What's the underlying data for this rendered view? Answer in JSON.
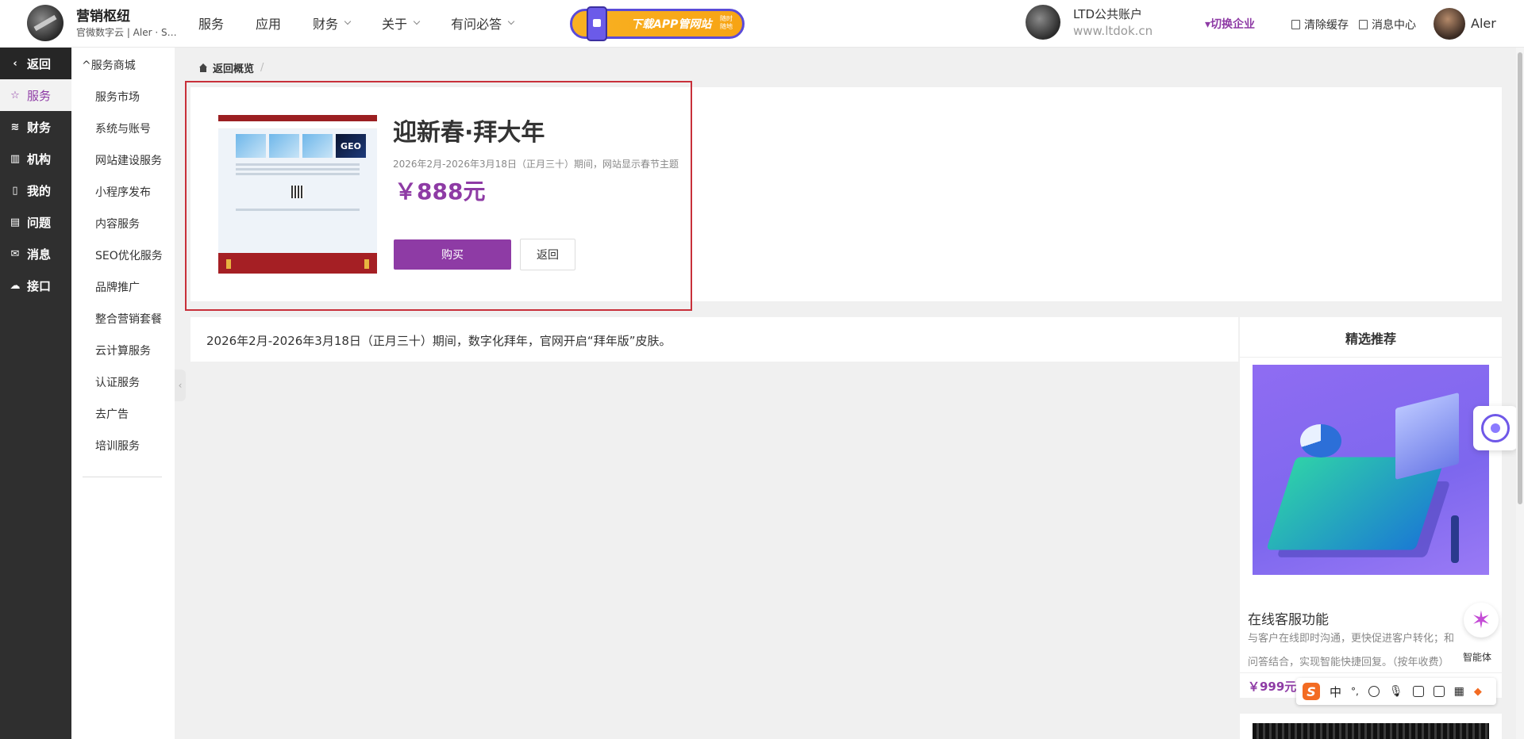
{
  "header": {
    "brand_title": "营销枢纽",
    "brand_subtitle": "官微数字云 | Aler · Se...",
    "nav": [
      {
        "label": "服务",
        "has_dropdown": false
      },
      {
        "label": "应用",
        "has_dropdown": false
      },
      {
        "label": "财务",
        "has_dropdown": true
      },
      {
        "label": "关于",
        "has_dropdown": true
      },
      {
        "label": "有问必答",
        "has_dropdown": true
      }
    ],
    "app_banner": {
      "text": "下载APP管网站",
      "small_text": "随时随地"
    },
    "account_name": "LTD公共账户",
    "account_url": "www.ltdok.cn",
    "switch_enterprise": "▾切换企业",
    "clear_cache": "清除缓存",
    "message_center": "消息中心",
    "user_name": "Aler"
  },
  "sidebar_main": {
    "back_label": "返回",
    "items": [
      {
        "label": "服务",
        "icon": "star-icon",
        "active": true
      },
      {
        "label": "财务",
        "icon": "database-icon",
        "active": false
      },
      {
        "label": "机构",
        "icon": "building-icon",
        "active": false
      },
      {
        "label": "我的",
        "icon": "bookmark-icon",
        "active": false
      },
      {
        "label": "问题",
        "icon": "document-icon",
        "active": false
      },
      {
        "label": "消息",
        "icon": "mail-icon",
        "active": false
      },
      {
        "label": "接口",
        "icon": "cloud-icon",
        "active": false
      }
    ]
  },
  "sidebar_sub": {
    "heading": "服务商城",
    "items": [
      "服务市场",
      "系统与账号",
      "网站建设服务",
      "小程序发布",
      "内容服务",
      "SEO优化服务",
      "品牌推广",
      "整合营销套餐",
      "云计算服务",
      "认证服务",
      "去广告",
      "培训服务"
    ]
  },
  "breadcrumb": {
    "home": "返回概览",
    "separator": "/"
  },
  "product": {
    "title": "迎新春·拜大年",
    "description": "2026年2月-2026年3月18日（正月三十）期间，网站显示春节主题",
    "price": "￥888元",
    "buy_label": "购买",
    "back_label": "返回",
    "thumbnail_texts": [
      "GEO"
    ]
  },
  "detail_text": "2026年2月-2026年3月18日（正月三十）期间，数字化拜年，官网开启“拜年版”皮肤。",
  "recommend": {
    "title": "精选推荐",
    "item_name": "在线客服功能",
    "summary_line1": "与客户在线即时沟通，更快促进客户转化；和",
    "summary_line2": "问答结合，实现智能快捷回复。（按年收费）",
    "price": "￥999元"
  },
  "floating": {
    "agent_label": "智能体",
    "ime_items": [
      "中",
      "°,"
    ]
  },
  "colors": {
    "accent": "#8e3ba5",
    "sidebar_dark": "#2f2f2f",
    "highlight_border": "#c8303a",
    "banner_orange": "#f7a414"
  }
}
